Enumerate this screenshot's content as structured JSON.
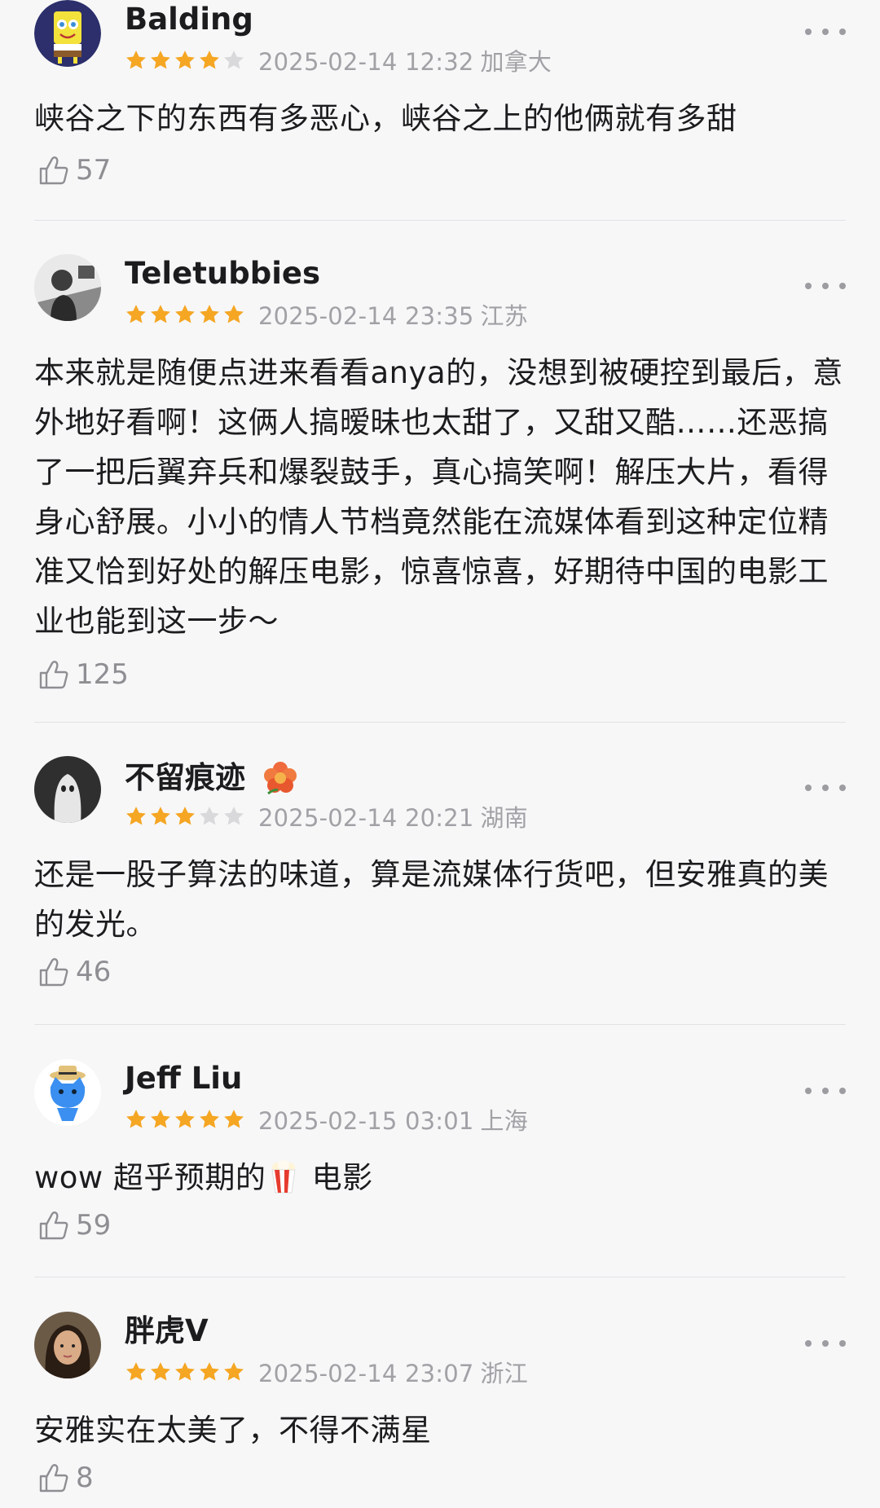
{
  "colors": {
    "star_filled": "#f5a623",
    "star_empty": "#d9d9dc",
    "meta_text": "#a1a1a6",
    "like_text": "#8e8e93",
    "background": "#f7f7f8"
  },
  "reviews": [
    {
      "username": "Balding",
      "avatar_icon": "spongebob-avatar-icon",
      "rating": 4,
      "max_rating": 5,
      "timestamp": "2025-02-14 12:32",
      "location": "加拿大",
      "content": "峡谷之下的东西有多恶心，峡谷之上的他俩就有多甜",
      "likes": "57"
    },
    {
      "username": "Teletubbies",
      "avatar_icon": "person-photo-avatar-icon",
      "rating": 5,
      "max_rating": 5,
      "timestamp": "2025-02-14 23:35",
      "location": "江苏",
      "content": "本来就是随便点进来看看anya的，没想到被硬控到最后，意外地好看啊！这俩人搞暧昧也太甜了，又甜又酷……还恶搞了一把后翼弃兵和爆裂鼓手，真心搞笑啊！解压大片，看得身心舒展。小小的情人节档竟然能在流媒体看到这种定位精准又恰到好处的解压电影，惊喜惊喜，好期待中国的电影工业也能到这一步～",
      "likes": "125"
    },
    {
      "username": "不留痕迹",
      "name_badge_icon": "flower-icon",
      "avatar_icon": "ghost-avatar-icon",
      "rating": 3,
      "max_rating": 5,
      "timestamp": "2025-02-14 20:21",
      "location": "湖南",
      "content": "还是一股子算法的味道，算是流媒体行货吧，但安雅真的美的发光。",
      "likes": "46"
    },
    {
      "username": "Jeff Liu",
      "avatar_icon": "blue-cat-avatar-icon",
      "rating": 5,
      "max_rating": 5,
      "timestamp": "2025-02-15 03:01",
      "location": "上海",
      "content_before": "wow 超乎预期的",
      "content_emoji": "popcorn-icon",
      "content_after": " 电影",
      "likes": "59"
    },
    {
      "username": "胖虎V",
      "avatar_icon": "woman-photo-avatar-icon",
      "rating": 5,
      "max_rating": 5,
      "timestamp": "2025-02-14 23:07",
      "location": "浙江",
      "content": "安雅实在太美了，不得不满星",
      "likes": "8"
    }
  ]
}
